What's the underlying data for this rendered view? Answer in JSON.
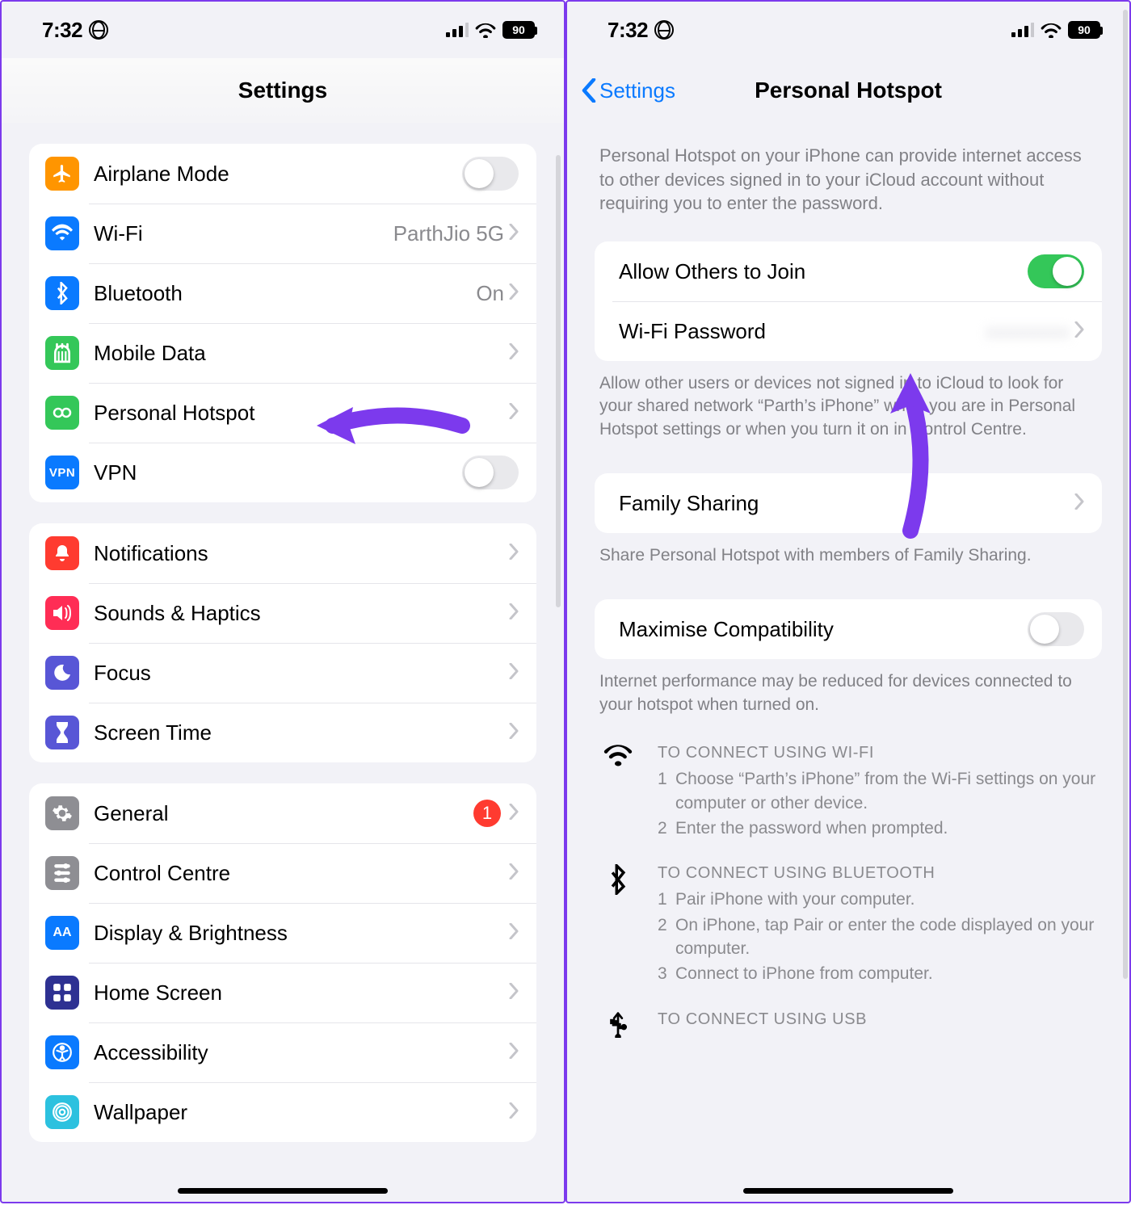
{
  "status": {
    "time": "7:32",
    "battery": "90"
  },
  "left": {
    "title": "Settings",
    "groups": [
      [
        {
          "icon": "airplane",
          "label": "Airplane Mode",
          "kind": "switch",
          "on": false
        },
        {
          "icon": "wifi",
          "label": "Wi-Fi",
          "detail": "ParthJio 5G",
          "kind": "nav"
        },
        {
          "icon": "bt",
          "label": "Bluetooth",
          "detail": "On",
          "kind": "nav"
        },
        {
          "icon": "mobile",
          "label": "Mobile Data",
          "kind": "nav"
        },
        {
          "icon": "hotspot",
          "label": "Personal Hotspot",
          "kind": "nav",
          "highlighted": true
        },
        {
          "icon": "vpn",
          "label": "VPN",
          "kind": "switch",
          "on": false
        }
      ],
      [
        {
          "icon": "notif",
          "label": "Notifications",
          "kind": "nav"
        },
        {
          "icon": "sound",
          "label": "Sounds & Haptics",
          "kind": "nav"
        },
        {
          "icon": "focus",
          "label": "Focus",
          "kind": "nav"
        },
        {
          "icon": "screentime",
          "label": "Screen Time",
          "kind": "nav"
        }
      ],
      [
        {
          "icon": "general",
          "label": "General",
          "kind": "nav",
          "badge": "1"
        },
        {
          "icon": "control",
          "label": "Control Centre",
          "kind": "nav"
        },
        {
          "icon": "display",
          "label": "Display & Brightness",
          "kind": "nav"
        },
        {
          "icon": "home",
          "label": "Home Screen",
          "kind": "nav"
        },
        {
          "icon": "access",
          "label": "Accessibility",
          "kind": "nav"
        },
        {
          "icon": "wall",
          "label": "Wallpaper",
          "kind": "nav"
        }
      ]
    ]
  },
  "right": {
    "back": "Settings",
    "title": "Personal Hotspot",
    "intro": "Personal Hotspot on your iPhone can provide internet access to other devices signed in to your iCloud account without requiring you to enter the password.",
    "rows1": [
      {
        "label": "Allow Others to Join",
        "kind": "switch",
        "on": true
      },
      {
        "label": "Wi-Fi Password",
        "kind": "nav",
        "detail_blur": "xxxxxxxx"
      }
    ],
    "note1": "Allow other users or devices not signed in to iCloud to look for your shared network “Parth’s iPhone” when you are in Personal Hotspot settings or when you turn it on in Control Centre.",
    "rows2": [
      {
        "label": "Family Sharing",
        "kind": "nav"
      }
    ],
    "note2": "Share Personal Hotspot with members of Family Sharing.",
    "rows3": [
      {
        "label": "Maximise Compatibility",
        "kind": "switch",
        "on": false
      }
    ],
    "note3": "Internet performance may be reduced for devices connected to your hotspot when turned on.",
    "connect": [
      {
        "icon": "wifi",
        "h": "TO CONNECT USING WI-FI",
        "steps": [
          "Choose “Parth’s iPhone” from the Wi-Fi settings on your computer or other device.",
          "Enter the password when prompted."
        ]
      },
      {
        "icon": "bt",
        "h": "TO CONNECT USING BLUETOOTH",
        "steps": [
          "Pair iPhone with your computer.",
          "On iPhone, tap Pair or enter the code displayed on your computer.",
          "Connect to iPhone from computer."
        ]
      },
      {
        "icon": "usb",
        "h": "TO CONNECT USING USB",
        "steps": []
      }
    ]
  },
  "iconColors": {
    "airplane": "#ff9500",
    "wifi": "#0a7aff",
    "bt": "#0a7aff",
    "mobile": "#34c759",
    "hotspot": "#34c759",
    "vpn": "#0a7aff",
    "notif": "#ff3b30",
    "sound": "#ff2d55",
    "focus": "#5856d6",
    "screentime": "#5856d6",
    "general": "#8e8e93",
    "control": "#8e8e93",
    "display": "#0a7aff",
    "home": "#2e3192",
    "access": "#0a7aff",
    "wall": "#2cc1df"
  }
}
